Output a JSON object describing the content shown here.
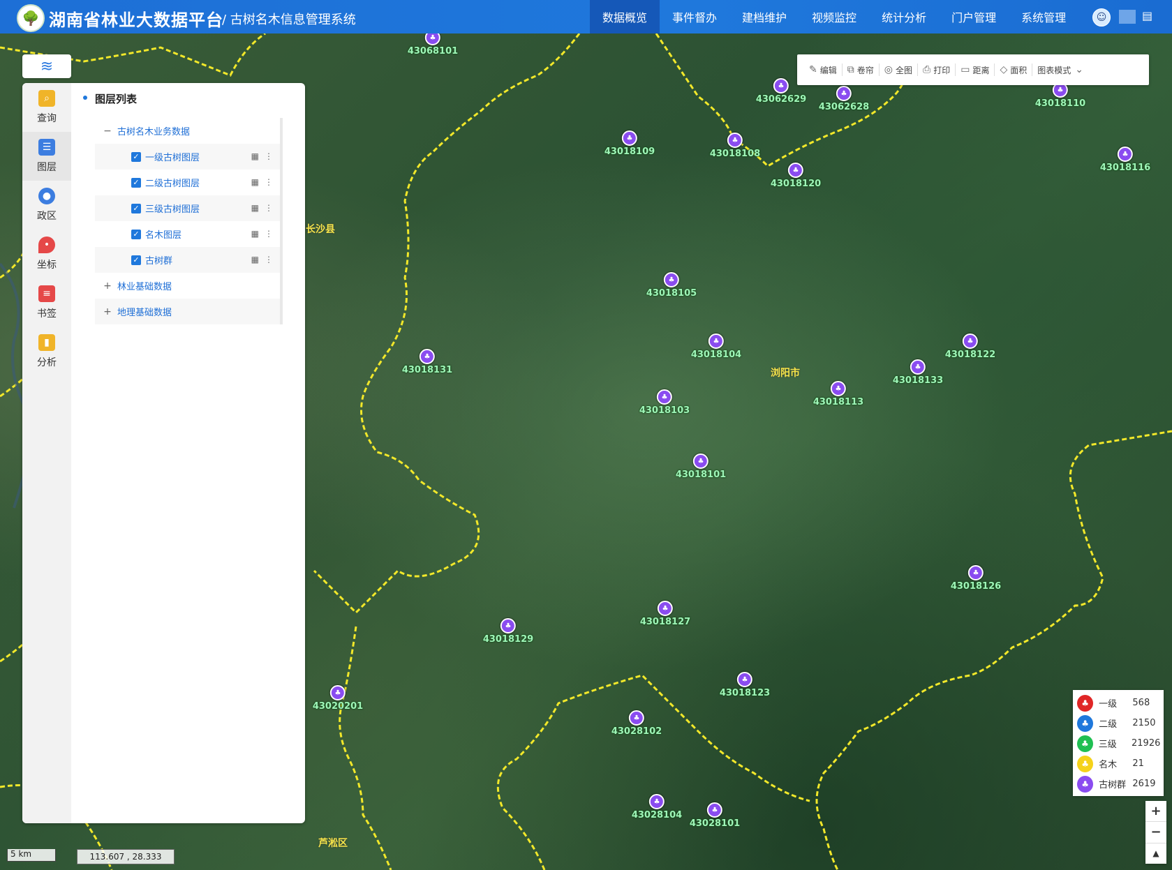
{
  "header": {
    "logo_icon": "tree-logo-icon",
    "title": "湖南省林业大数据平台",
    "subtitle": "/ 古树名木信息管理系统",
    "nav": [
      {
        "label": "数据概览",
        "active": true
      },
      {
        "label": "事件督办"
      },
      {
        "label": "建档维护"
      },
      {
        "label": "视频监控"
      },
      {
        "label": "统计分析"
      },
      {
        "label": "门户管理"
      },
      {
        "label": "系统管理"
      }
    ]
  },
  "toolbar": [
    {
      "icon": "edit-icon",
      "label": "编辑"
    },
    {
      "icon": "layers-swipe-icon",
      "label": "卷帘"
    },
    {
      "icon": "globe-icon",
      "label": "全图"
    },
    {
      "icon": "printer-icon",
      "label": "打印"
    },
    {
      "icon": "ruler-icon",
      "label": "距离"
    },
    {
      "icon": "area-icon",
      "label": "面积"
    },
    {
      "icon": "chevron-down-icon",
      "label": "图表模式"
    }
  ],
  "sidebar": [
    {
      "label": "查询",
      "icon": "search-icon",
      "color": "#f0b429"
    },
    {
      "label": "图层",
      "icon": "layers-icon",
      "color": "#3c7de0",
      "active": true
    },
    {
      "label": "政区",
      "icon": "region-icon",
      "color": "#3c7de0"
    },
    {
      "label": "坐标",
      "icon": "location-pin-icon",
      "color": "#e54848"
    },
    {
      "label": "书签",
      "icon": "bookmark-icon",
      "color": "#e54848"
    },
    {
      "label": "分析",
      "icon": "bar-chart-icon",
      "color": "#f0b429"
    }
  ],
  "layer_panel": {
    "title": "图层列表",
    "groups": [
      {
        "label": "古树名木业务数据",
        "expanded": true,
        "children": [
          "一级古树图层",
          "二级古树图层",
          "三级古树图层",
          "名木图层",
          "古树群"
        ]
      },
      {
        "label": "林业基础数据",
        "expanded": false
      },
      {
        "label": "地理基础数据",
        "expanded": false
      }
    ]
  },
  "map": {
    "markers": [
      {
        "code": "43068101",
        "pos": [
          620,
          62
        ]
      },
      {
        "code": "43062629",
        "pos": [
          1119,
          131
        ]
      },
      {
        "code": "43062628",
        "pos": [
          1209,
          142
        ]
      },
      {
        "code": "43018110",
        "pos": [
          1519,
          137
        ]
      },
      {
        "code": "43018109",
        "pos": [
          902,
          206
        ]
      },
      {
        "code": "43018108",
        "pos": [
          1053,
          209
        ]
      },
      {
        "code": "43018116",
        "pos": [
          1612,
          229
        ]
      },
      {
        "code": "43018120",
        "pos": [
          1140,
          252
        ]
      },
      {
        "code": "43018105",
        "pos": [
          962,
          409
        ]
      },
      {
        "code": "43018104",
        "pos": [
          1026,
          497
        ]
      },
      {
        "code": "43018122",
        "pos": [
          1390,
          497
        ]
      },
      {
        "code": "43018133",
        "pos": [
          1315,
          534
        ]
      },
      {
        "code": "43018131",
        "pos": [
          612,
          519
        ]
      },
      {
        "code": "43018113",
        "pos": [
          1201,
          565
        ]
      },
      {
        "code": "43018103",
        "pos": [
          952,
          577
        ]
      },
      {
        "code": "43018101",
        "pos": [
          1004,
          669
        ]
      },
      {
        "code": "43018126",
        "pos": [
          1398,
          829
        ]
      },
      {
        "code": "43018127",
        "pos": [
          953,
          880
        ]
      },
      {
        "code": "43018129",
        "pos": [
          728,
          905
        ]
      },
      {
        "code": "43018123",
        "pos": [
          1067,
          982
        ]
      },
      {
        "code": "43020201",
        "pos": [
          484,
          1001
        ]
      },
      {
        "code": "43028102",
        "pos": [
          912,
          1037
        ]
      },
      {
        "code": "43028104",
        "pos": [
          941,
          1157
        ]
      },
      {
        "code": "43028101",
        "pos": [
          1024,
          1169
        ]
      }
    ],
    "places": [
      {
        "name": "长沙县",
        "pos": [
          438,
          318
        ]
      },
      {
        "name": "浏阳市",
        "pos": [
          1104,
          524
        ]
      },
      {
        "name": "芦淞区",
        "pos": [
          456,
          1198
        ]
      }
    ]
  },
  "legend": [
    {
      "icon": "tree-red-icon",
      "label": "一级",
      "count": "568",
      "color": "#e02626"
    },
    {
      "icon": "tree-blue-icon",
      "label": "二级",
      "count": "2150",
      "color": "#1f78dc"
    },
    {
      "icon": "tree-green-icon",
      "label": "三级",
      "count": "21926",
      "color": "#1fbf52"
    },
    {
      "icon": "tree-yellow-icon",
      "label": "名木",
      "count": "21",
      "color": "#f5d21a"
    },
    {
      "icon": "tree-group-icon",
      "label": "古树群",
      "count": "2619",
      "color": "#8a4cf0"
    }
  ],
  "zoom": {
    "in": "+",
    "out": "−",
    "north": "▲"
  },
  "scale_label": "5 km",
  "coordinates": "113.607 , 28.333"
}
